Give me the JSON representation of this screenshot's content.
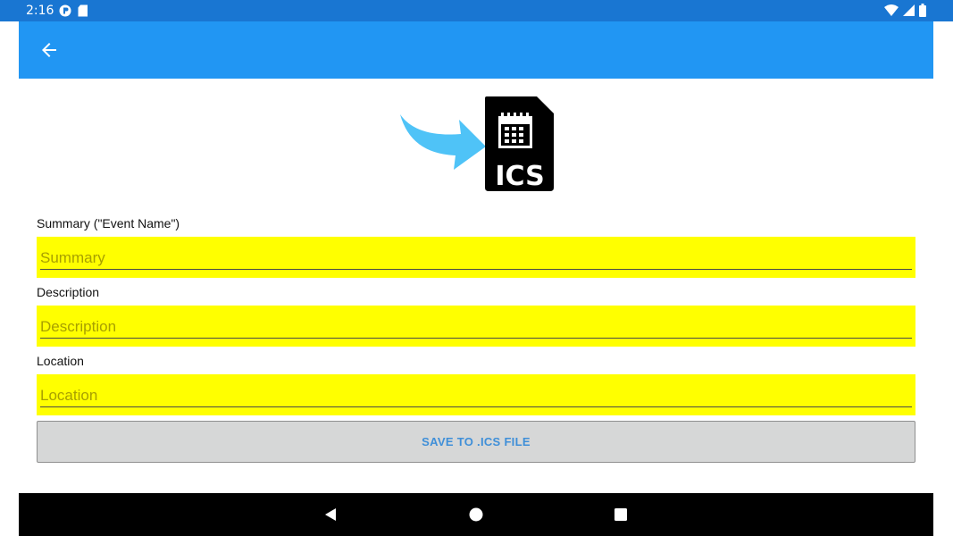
{
  "status_bar": {
    "time": "2:16",
    "left_icons": [
      "notification-app-icon",
      "sd-card-icon"
    ],
    "right_icons": [
      "wifi-icon",
      "cell-signal-icon",
      "battery-icon"
    ]
  },
  "app_bar": {
    "back_icon": "arrow-back-icon",
    "color": "#2196f3"
  },
  "hero": {
    "icon": "ics-file-import-icon",
    "file_label": "ICS",
    "arrow_color": "#4fc3f7"
  },
  "form": {
    "summary": {
      "label": "Summary (\"Event Name\")",
      "placeholder": "Summary",
      "value": ""
    },
    "description": {
      "label": "Description",
      "placeholder": "Description",
      "value": ""
    },
    "location": {
      "label": "Location",
      "placeholder": "Location",
      "value": ""
    },
    "field_background": "#ffff00",
    "save_label": "SAVE TO .ICS FILE"
  },
  "nav_bar": {
    "buttons": [
      "back-triangle-icon",
      "home-circle-icon",
      "recents-square-icon"
    ]
  }
}
